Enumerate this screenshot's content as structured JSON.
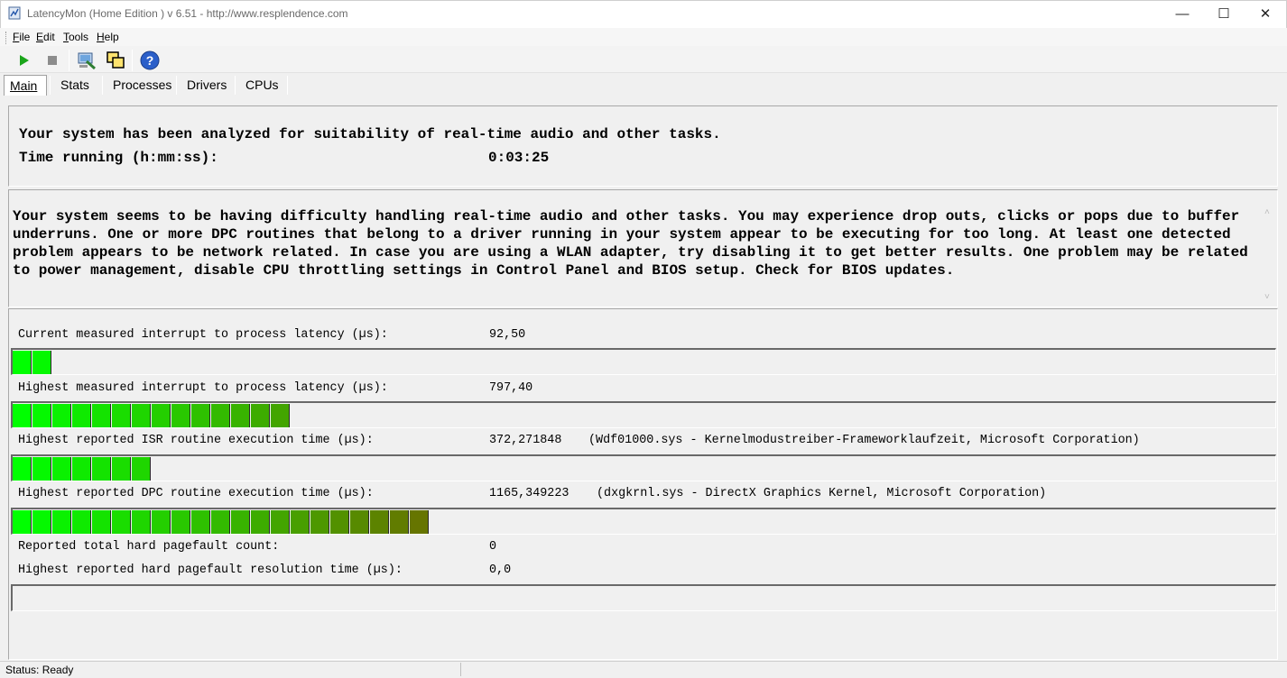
{
  "window": {
    "title": "LatencyMon  (Home Edition )  v 6.51 - http://www.resplendence.com",
    "minimize_glyph": "—",
    "maximize_glyph": "☐",
    "close_glyph": "✕"
  },
  "menu": [
    {
      "label": "File",
      "accel": "F"
    },
    {
      "label": "Edit",
      "accel": "E"
    },
    {
      "label": "Tools",
      "accel": "T"
    },
    {
      "label": "Help",
      "accel": "H"
    }
  ],
  "toolbar": {
    "icons": [
      "play-icon",
      "stop-icon",
      "monitor-tool-icon",
      "window-copy-icon",
      "help-icon"
    ],
    "play_color": "#1aa51a",
    "stop_color": "#8c8c8c",
    "help_color": "#2b5fc9"
  },
  "tabs": [
    "Main",
    "Stats",
    "Processes",
    "Drivers",
    "CPUs"
  ],
  "main": {
    "summary_line": "Your system has been analyzed for suitability of real-time audio and other tasks.",
    "time_label": "Time running (h:mm:ss):",
    "time_value": "0:03:25",
    "message": "Your system seems to be having difficulty handling real-time audio and other tasks. You may experience drop outs, clicks or pops due to buffer underruns. One or more DPC routines that belong to a driver running in your system appear to be executing for too long. At least one detected problem appears to be network related. In case you are using a WLAN adapter, try disabling it to get better results. One problem may be related to power management, disable CPU throttling settings in Control Panel and BIOS setup. Check for BIOS updates.",
    "metrics": {
      "current_latency_label": "Current measured interrupt to process latency (µs):",
      "current_latency_value": "92,50",
      "highest_latency_label": "Highest measured interrupt to process latency (µs):",
      "highest_latency_value": "797,40",
      "isr_label": "Highest reported ISR routine execution time (µs):",
      "isr_value": "372,271848",
      "isr_driver": "(Wdf01000.sys - Kernelmodustreiber-Frameworklaufzeit, Microsoft Corporation)",
      "dpc_label": "Highest reported DPC routine execution time (µs):",
      "dpc_value": "1165,349223",
      "dpc_driver": "(dxgkrnl.sys - DirectX Graphics Kernel, Microsoft Corporation)",
      "pagefault_count_label": "Reported total hard pagefault count:",
      "pagefault_count_value": "0",
      "pagefault_time_label": "Highest reported hard pagefault resolution time (µs):",
      "pagefault_time_value": "0,0"
    },
    "bars": {
      "current_latency": 0.03,
      "highest_latency": 0.223,
      "isr": 0.108,
      "dpc": 0.328,
      "pagefault": 0
    },
    "bar_colors": {
      "start": "#00ff00",
      "end": "#6b6f00"
    }
  },
  "status": {
    "text": "Status: Ready"
  }
}
